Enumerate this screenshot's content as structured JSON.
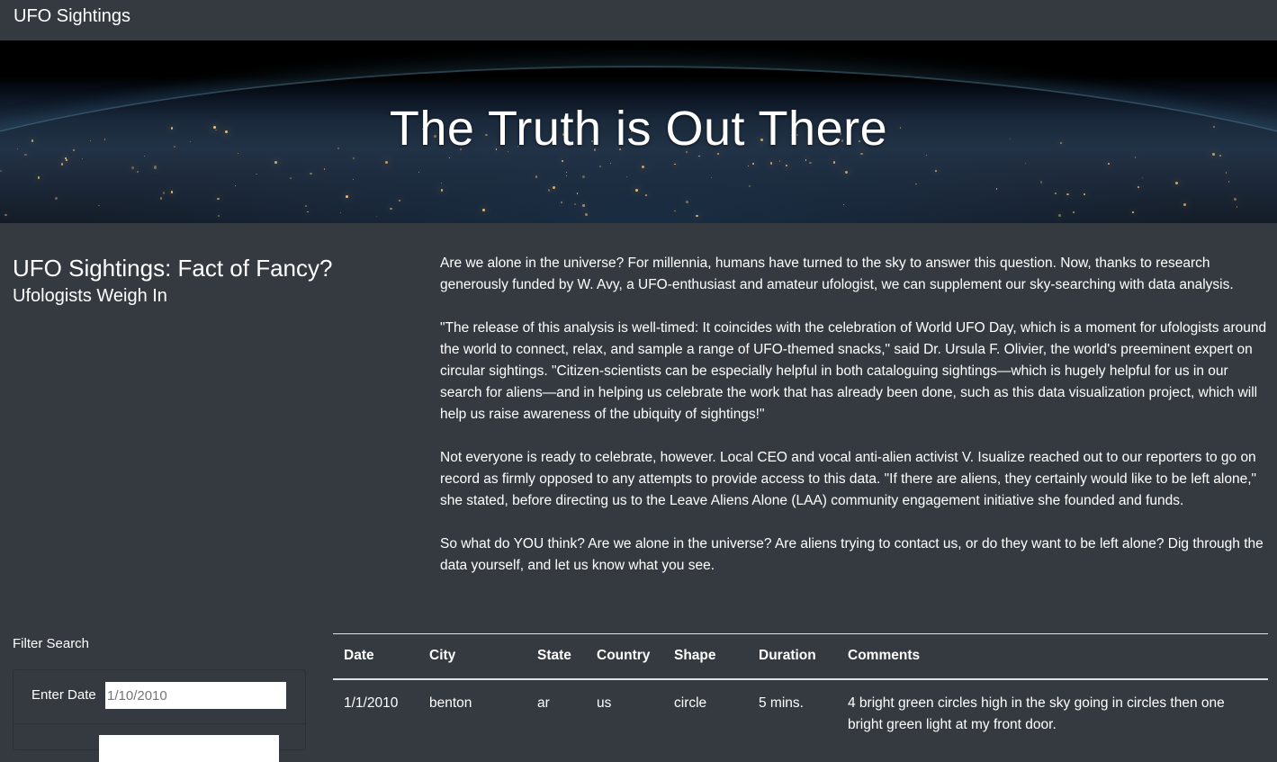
{
  "navbar": {
    "brand": "UFO Sightings"
  },
  "hero": {
    "title": "The Truth is Out There"
  },
  "intro": {
    "title": "UFO Sightings: Fact of Fancy?",
    "subtitle": "Ufologists Weigh In"
  },
  "article": {
    "paragraphs": [
      "Are we alone in the universe? For millennia, humans have turned to the sky to answer this question. Now, thanks to research generously funded by W. Avy, a UFO-enthusiast and amateur ufologist, we can supplement our sky-searching with data analysis.",
      "\"The release of this analysis is well-timed: It coincides with the celebration of World UFO Day, which is a moment for ufologists around the world to connect, relax, and sample a range of UFO-themed snacks,\" said Dr. Ursula F. Olivier, the world's preeminent expert on circular sightings. \"Citizen-scientists can be especially helpful in both cataloguing sightings—which is hugely helpful for us in our search for aliens—and in helping us celebrate the work that has already been done, such as this data visualization project, which will help us raise awareness of the ubiquity of sightings!\"",
      "Not everyone is ready to celebrate, however. Local CEO and vocal anti-alien activist V. Isualize reached out to our reporters to go on record as firmly opposed to any attempts to provide access to this data. \"If there are aliens, they certainly would like to be left alone,\" she stated, before directing us to the Leave Aliens Alone (LAA) community engagement initiative she founded and funds.",
      "So what do YOU think? Are we alone in the universe? Are aliens trying to contact us, or do they want to be left alone? Dig through the data yourself, and let us know what you see."
    ]
  },
  "filter": {
    "heading": "Filter Search",
    "date_label": "Enter Date",
    "date_placeholder": "1/10/2010"
  },
  "table": {
    "headers": [
      "Date",
      "City",
      "State",
      "Country",
      "Shape",
      "Duration",
      "Comments"
    ],
    "rows": [
      [
        "1/1/2010",
        "benton",
        "ar",
        "us",
        "circle",
        "5 mins.",
        "4 bright green circles high in the sky going in circles then one bright green light at my front door."
      ]
    ]
  }
}
